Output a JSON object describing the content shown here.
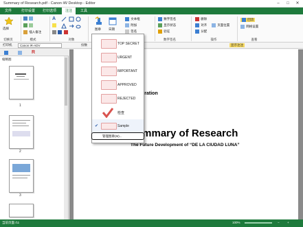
{
  "window": {
    "title": "Summary of Research.pdf - Canon iW Desktop - Editor",
    "min_label": "–",
    "max_label": "□",
    "close_label": "✕"
  },
  "menubar": {
    "tabs": [
      {
        "label": "文件"
      },
      {
        "label": "打印设置"
      },
      {
        "label": "打印选项"
      },
      {
        "label": "注注"
      },
      {
        "label": "工具"
      }
    ]
  },
  "ribbon": {
    "group_labels": [
      "切换页",
      "模式",
      "对象",
      "",
      "",
      "数字签名",
      "操作",
      "查看"
    ],
    "items": {
      "select_label": "选择",
      "insert_label": "插入备注",
      "stamp_label": "图章",
      "date_label": "日期",
      "textbox_label": "文本框",
      "attach_label": "附加",
      "signature_label": "签名",
      "digital_sig_label": "数字签名",
      "display_status_label": "显示状态",
      "verify_label": "验证",
      "delete_label": "删除",
      "align_label": "对齐",
      "distribute_label": "分配",
      "page_position_label": "页面位置",
      "reflow_label": "回流",
      "grid_label": "网格设置"
    }
  },
  "propbar": {
    "printer_label": "打印机",
    "printer_value": "Canon iR-ADV",
    "copies_label": "份数",
    "show_annot_label": "显示注注"
  },
  "sidepanel": {
    "title": "缩略图",
    "thumbs": [
      "1",
      "2",
      "3"
    ]
  },
  "document": {
    "corp_text": "oration",
    "heading": "Summary of Research",
    "subheading": "The Future Development of “DE LA CIUDAD LUNA”"
  },
  "stamp_menu": {
    "items": [
      {
        "label": "TOP SECRET",
        "checked": false
      },
      {
        "label": "URGENT",
        "checked": false
      },
      {
        "label": "IMPORTANT",
        "checked": false
      },
      {
        "label": "APPROVED",
        "checked": false
      },
      {
        "label": "REJECTED",
        "checked": false
      },
      {
        "label": "检查",
        "checked": false
      },
      {
        "label": "Sample",
        "checked": true
      }
    ],
    "manage_label": "管理图章(M)...",
    "check_mark": "✔",
    "stamp_color": "#d9534f"
  },
  "statusbar": {
    "page_text": "当前页面 /11",
    "zoom_text": "100%"
  },
  "colors": {
    "accent": "#1e7a3c"
  }
}
